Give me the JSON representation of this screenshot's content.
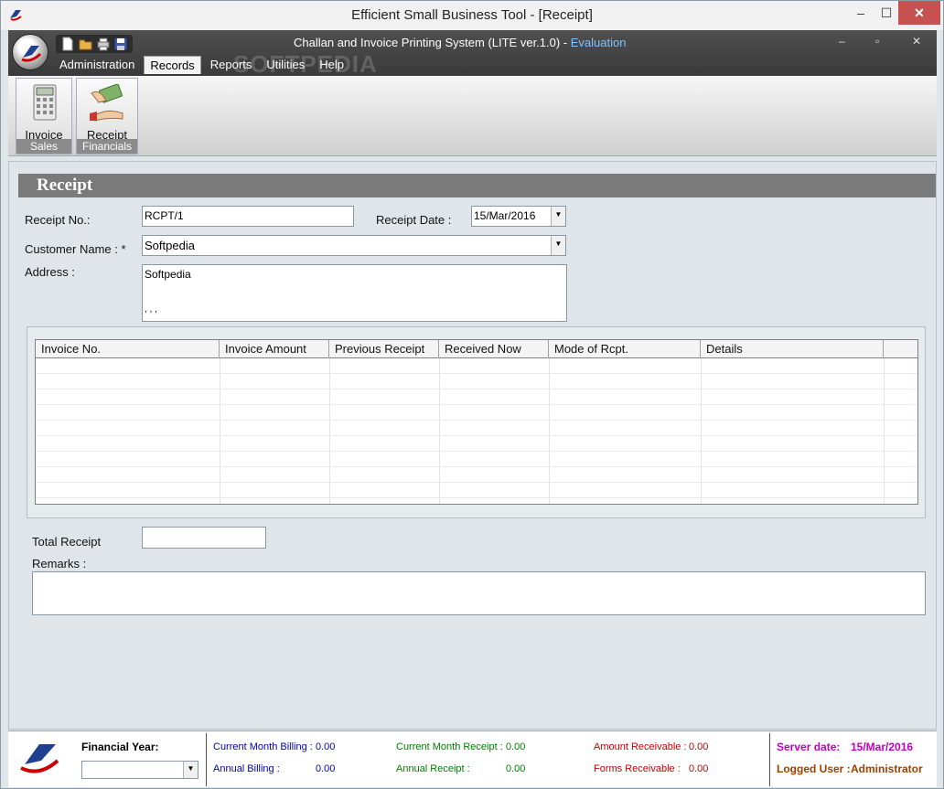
{
  "window": {
    "title": "Efficient Small Business Tool - [Receipt]",
    "min": "–",
    "max": "☐",
    "close": "✕"
  },
  "app": {
    "subtitle": "Challan and Invoice Printing System (LITE ver.1.0) - ",
    "edition": "Evaluation",
    "watermark": "SOFTPEDIA",
    "inner_min": "–",
    "inner_max": "▫",
    "inner_close": "✕"
  },
  "menu": [
    {
      "label": "Administration",
      "active": false
    },
    {
      "label": "Records",
      "active": true
    },
    {
      "label": "Reports",
      "active": false
    },
    {
      "label": "Utilities",
      "active": false
    },
    {
      "label": "Help",
      "active": false
    }
  ],
  "quick_access": [
    "new-icon",
    "open-icon",
    "print-icon",
    "save-icon"
  ],
  "ribbon": {
    "groups": [
      {
        "name": "Sales",
        "button": "Invoice",
        "icon": "calculator-icon"
      },
      {
        "name": "Financials",
        "button": "Receipt",
        "icon": "cash-payment-icon"
      }
    ]
  },
  "form": {
    "heading": "Receipt",
    "receipt_no_label": "Receipt No.:",
    "receipt_no": "RCPT/1",
    "receipt_date_label": "Receipt Date :",
    "receipt_date": "15/Mar/2016",
    "customer_name_label": "Customer Name : *",
    "customer_name": "Softpedia",
    "address_label": "Address :",
    "address_line1": "Softpedia",
    "address_line2": ", , ,",
    "total_receipt_label": "Total Receipt",
    "total_receipt": "",
    "remarks_label": "Remarks :",
    "remarks": ""
  },
  "grid": {
    "columns": [
      "Invoice No.",
      "Invoice Amount",
      "Previous Receipt",
      "Received Now",
      "Mode of Rcpt.",
      "Details"
    ],
    "rows": []
  },
  "status": {
    "financial_year_label": "Financial Year:",
    "financial_year": "",
    "current_month_billing_label": "Current Month Billing :",
    "current_month_billing": "0.00",
    "annual_billing_label": "Annual Billing :",
    "annual_billing": "0.00",
    "current_month_receipt_label": "Current Month Receipt :",
    "current_month_receipt": "0.00",
    "annual_receipt_label": "Annual Receipt :",
    "annual_receipt": "0.00",
    "amount_receivable_label": "Amount Receivable :",
    "amount_receivable": "0.00",
    "forms_receivable_label": "Forms Receivable :",
    "forms_receivable": "0.00",
    "server_date_label": "Server date:",
    "server_date": "15/Mar/2016",
    "logged_user_label": "Logged User :",
    "logged_user": "Administrator"
  },
  "colors": {
    "billing": "#0000c8",
    "receipt": "#008000",
    "receivable": "#c80000",
    "server": "#c000c0",
    "user": "#a04000",
    "evaluation": "#7fc4ff"
  }
}
